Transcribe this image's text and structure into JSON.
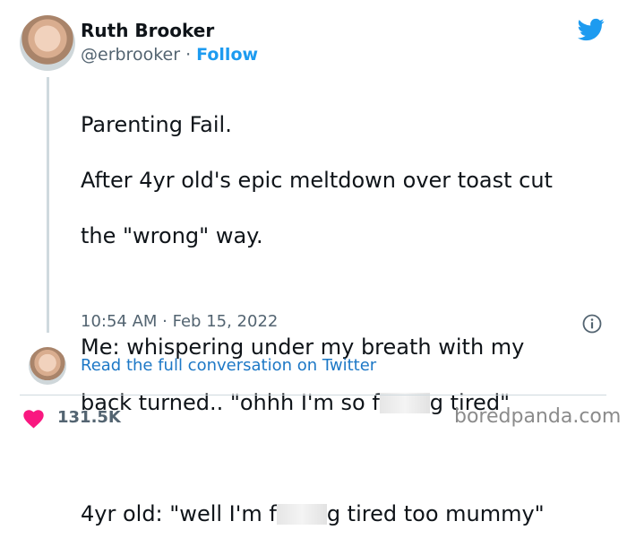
{
  "tweet": {
    "author": {
      "name": "Ruth Brooker",
      "handle": "@erbrooker",
      "separator": " · ",
      "follow_label": "Follow"
    },
    "text": {
      "line_1": "Parenting Fail.",
      "line_2": "After 4yr old's epic meltdown over toast cut",
      "line_3": "the \"wrong\" way.",
      "line_4": "Me: whispering under my breath with my",
      "line_5a": "back turned.. \"ohhh I'm so f",
      "line_5b": "g tired\"",
      "line_6a": "4yr old: \"well I'm f",
      "line_6b": "g tired too mummy\""
    },
    "timestamp": "10:54 AM · Feb 15, 2022",
    "read_conversation_label": "Read the full conversation on Twitter",
    "likes_count": "131.5K"
  },
  "icons": {
    "brand": "twitter-bird-icon",
    "info": "info-icon",
    "like": "heart-icon"
  },
  "colors": {
    "twitter_blue": "#1d9bf0",
    "heart": "#f91880",
    "secondary_text": "#536471"
  },
  "watermark": "boredpanda.com"
}
